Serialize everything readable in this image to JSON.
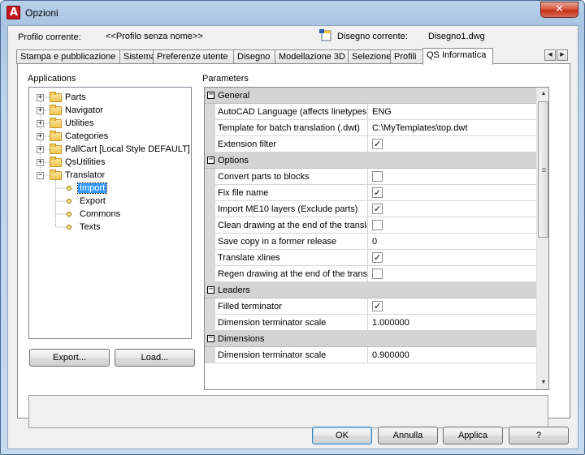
{
  "window": {
    "title": "Opzioni",
    "close_glyph": "✕"
  },
  "header": {
    "profile_label": "Profilo corrente:",
    "profile_value": "<<Profilo senza nome>>",
    "drawing_label": "Disegno corrente:",
    "drawing_value": "Disegno1.dwg"
  },
  "tabs": [
    {
      "label": "Stampa e pubblicazione",
      "active": false
    },
    {
      "label": "Sistema",
      "active": false
    },
    {
      "label": "Preferenze utente",
      "active": false
    },
    {
      "label": "Disegno",
      "active": false
    },
    {
      "label": "Modellazione 3D",
      "active": false
    },
    {
      "label": "Selezione",
      "active": false
    },
    {
      "label": "Profili",
      "active": false
    },
    {
      "label": "QS Informatica",
      "active": true
    }
  ],
  "tab_scroll": {
    "left": "◀",
    "right": "▶"
  },
  "applications": {
    "label": "Applications",
    "tree": [
      {
        "label": "Parts",
        "expanded": false
      },
      {
        "label": "Navigator",
        "expanded": false
      },
      {
        "label": "Utilities",
        "expanded": false
      },
      {
        "label": "Categories",
        "expanded": false
      },
      {
        "label": "PallCart [Local Style DEFAULT]",
        "expanded": false
      },
      {
        "label": "QsUtilities",
        "expanded": false
      },
      {
        "label": "Translator",
        "expanded": true,
        "children": [
          {
            "label": "Import",
            "selected": true
          },
          {
            "label": "Export",
            "selected": false
          },
          {
            "label": "Commons",
            "selected": false
          },
          {
            "label": "Texts",
            "selected": false
          }
        ]
      }
    ],
    "export_button": "Export...",
    "load_button": "Load..."
  },
  "parameters": {
    "label": "Parameters",
    "sections": [
      {
        "title": "General",
        "rows": [
          {
            "name": "AutoCAD Language (affects linetypes)",
            "type": "text",
            "value": "ENG"
          },
          {
            "name": "Template for batch translation (.dwt)",
            "type": "text",
            "value": "C:\\MyTemplates\\top.dwt"
          },
          {
            "name": "Extension filter",
            "type": "check",
            "value": true
          }
        ]
      },
      {
        "title": "Options",
        "rows": [
          {
            "name": "Convert parts to blocks",
            "type": "check",
            "value": false
          },
          {
            "name": "Fix file name",
            "type": "check",
            "value": true
          },
          {
            "name": "Import ME10 layers (Exclude parts)",
            "type": "check",
            "value": true
          },
          {
            "name": "Clean drawing at the end of the translation",
            "type": "check",
            "value": false
          },
          {
            "name": "Save copy in a former release",
            "type": "text",
            "value": "0"
          },
          {
            "name": "Translate xlines",
            "type": "check",
            "value": true
          },
          {
            "name": "Regen drawing at the end of the translation",
            "type": "check",
            "value": false
          }
        ]
      },
      {
        "title": "Leaders",
        "rows": [
          {
            "name": "Filled terminator",
            "type": "check",
            "value": true
          },
          {
            "name": "Dimension terminator scale",
            "type": "text",
            "value": "1.000000"
          }
        ]
      },
      {
        "title": "Dimensions",
        "rows": [
          {
            "name": "Dimension terminator scale",
            "type": "text",
            "value": "0.900000"
          }
        ]
      }
    ]
  },
  "footer": {
    "ok": "OK",
    "cancel": "Annulla",
    "apply": "Applica",
    "help": "?"
  },
  "glyphs": {
    "collapse": "−",
    "expand": "+",
    "check": "✓",
    "scroll_up": "▲",
    "scroll_down": "▼"
  }
}
